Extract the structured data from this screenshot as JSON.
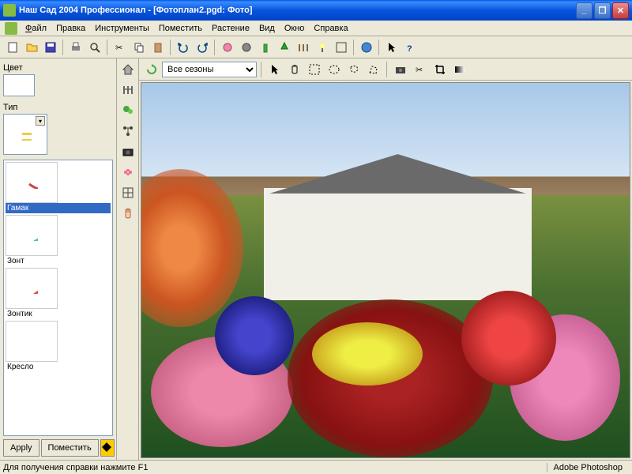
{
  "window": {
    "title": "Наш Сад 2004 Профессионал - [Фотоплан2.pgd: Фото]"
  },
  "menu": {
    "file": "Файл",
    "edit": "Правка",
    "tools": "Инструменты",
    "place": "Поместить",
    "plant": "Растение",
    "view": "Вид",
    "window": "Окно",
    "help": "Справка"
  },
  "left_panel": {
    "color_label": "Цвет",
    "type_label": "Тип",
    "items": [
      {
        "label": "Гамак"
      },
      {
        "label": "Зонт"
      },
      {
        "label": "Зонтик"
      },
      {
        "label": "Кресло"
      }
    ],
    "apply_btn": "Apply",
    "place_btn": "Поместить"
  },
  "canvas_toolbar": {
    "season_selected": "Все сезоны"
  },
  "statusbar": {
    "help_text": "Для получения справки нажмите F1",
    "right_text": "Adobe Photoshop"
  },
  "colors": {
    "titlebar": "#0855dd",
    "chrome": "#ece9d8",
    "selection": "#316ac5"
  }
}
